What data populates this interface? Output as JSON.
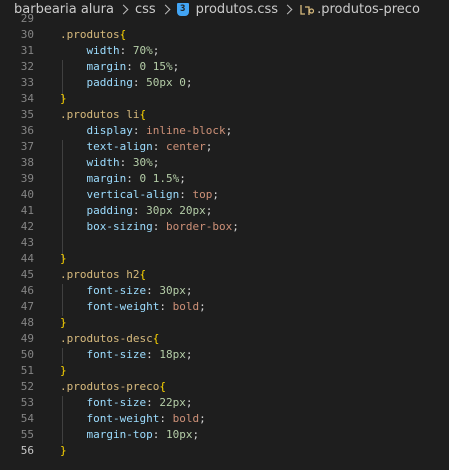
{
  "breadcrumb": {
    "folder1": "barbearia alura",
    "folder2": "css",
    "file": "produtos.css",
    "symbol": ".produtos-preco",
    "css_icon_glyph": "3",
    "css_icon_color": "#42a5f5"
  },
  "editor": {
    "active_line": 56,
    "lines": [
      {
        "n": "29",
        "tokens": []
      },
      {
        "n": "30",
        "tokens": [
          [
            "sel",
            ".produtos"
          ],
          [
            "brace",
            "{"
          ]
        ]
      },
      {
        "n": "31",
        "tokens": [
          [
            "pad",
            "    "
          ],
          [
            "prop",
            "width"
          ],
          [
            "pun",
            ": "
          ],
          [
            "num",
            "70%"
          ],
          [
            "pun",
            ";"
          ]
        ]
      },
      {
        "n": "32",
        "tokens": [
          [
            "pad",
            "    "
          ],
          [
            "prop",
            "margin"
          ],
          [
            "pun",
            ": "
          ],
          [
            "num",
            "0 15%"
          ],
          [
            "pun",
            ";"
          ]
        ]
      },
      {
        "n": "33",
        "tokens": [
          [
            "pad",
            "    "
          ],
          [
            "prop",
            "padding"
          ],
          [
            "pun",
            ": "
          ],
          [
            "num",
            "50px 0"
          ],
          [
            "pun",
            ";"
          ]
        ]
      },
      {
        "n": "34",
        "tokens": [
          [
            "brace",
            "}"
          ]
        ]
      },
      {
        "n": "35",
        "tokens": [
          [
            "sel",
            ".produtos li"
          ],
          [
            "brace",
            "{"
          ]
        ]
      },
      {
        "n": "36",
        "tokens": [
          [
            "pad",
            "    "
          ],
          [
            "prop",
            "display"
          ],
          [
            "pun",
            ": "
          ],
          [
            "val",
            "inline-block"
          ],
          [
            "pun",
            ";"
          ]
        ]
      },
      {
        "n": "37",
        "tokens": [
          [
            "pad",
            "    "
          ],
          [
            "prop",
            "text-align"
          ],
          [
            "pun",
            ": "
          ],
          [
            "val",
            "center"
          ],
          [
            "pun",
            ";"
          ]
        ]
      },
      {
        "n": "38",
        "tokens": [
          [
            "pad",
            "    "
          ],
          [
            "prop",
            "width"
          ],
          [
            "pun",
            ": "
          ],
          [
            "num",
            "30%"
          ],
          [
            "pun",
            ";"
          ]
        ]
      },
      {
        "n": "39",
        "tokens": [
          [
            "pad",
            "    "
          ],
          [
            "prop",
            "margin"
          ],
          [
            "pun",
            ": "
          ],
          [
            "num",
            "0 1.5%"
          ],
          [
            "pun",
            ";"
          ]
        ]
      },
      {
        "n": "40",
        "tokens": [
          [
            "pad",
            "    "
          ],
          [
            "prop",
            "vertical-align"
          ],
          [
            "pun",
            ": "
          ],
          [
            "val",
            "top"
          ],
          [
            "pun",
            ";"
          ]
        ]
      },
      {
        "n": "41",
        "tokens": [
          [
            "pad",
            "    "
          ],
          [
            "prop",
            "padding"
          ],
          [
            "pun",
            ": "
          ],
          [
            "num",
            "30px 20px"
          ],
          [
            "pun",
            ";"
          ]
        ]
      },
      {
        "n": "42",
        "tokens": [
          [
            "pad",
            "    "
          ],
          [
            "prop",
            "box-sizing"
          ],
          [
            "pun",
            ": "
          ],
          [
            "val",
            "border-box"
          ],
          [
            "pun",
            ";"
          ]
        ]
      },
      {
        "n": "43",
        "tokens": []
      },
      {
        "n": "44",
        "tokens": [
          [
            "brace",
            "}"
          ]
        ]
      },
      {
        "n": "45",
        "tokens": [
          [
            "sel",
            ".produtos h2"
          ],
          [
            "brace",
            "{"
          ]
        ]
      },
      {
        "n": "46",
        "tokens": [
          [
            "pad",
            "    "
          ],
          [
            "prop",
            "font-size"
          ],
          [
            "pun",
            ": "
          ],
          [
            "num",
            "30px"
          ],
          [
            "pun",
            ";"
          ]
        ]
      },
      {
        "n": "47",
        "tokens": [
          [
            "pad",
            "    "
          ],
          [
            "prop",
            "font-weight"
          ],
          [
            "pun",
            ": "
          ],
          [
            "val",
            "bold"
          ],
          [
            "pun",
            ";"
          ]
        ]
      },
      {
        "n": "48",
        "tokens": [
          [
            "brace",
            "}"
          ]
        ]
      },
      {
        "n": "49",
        "tokens": [
          [
            "sel",
            ".produtos-desc"
          ],
          [
            "brace",
            "{"
          ]
        ]
      },
      {
        "n": "50",
        "tokens": [
          [
            "pad",
            "    "
          ],
          [
            "prop",
            "font-size"
          ],
          [
            "pun",
            ": "
          ],
          [
            "num",
            "18px"
          ],
          [
            "pun",
            ";"
          ]
        ]
      },
      {
        "n": "51",
        "tokens": [
          [
            "brace",
            "}"
          ]
        ]
      },
      {
        "n": "52",
        "tokens": [
          [
            "sel",
            ".produtos-preco"
          ],
          [
            "brace",
            "{"
          ]
        ]
      },
      {
        "n": "53",
        "tokens": [
          [
            "pad",
            "    "
          ],
          [
            "prop",
            "font-size"
          ],
          [
            "pun",
            ": "
          ],
          [
            "num",
            "22px"
          ],
          [
            "pun",
            ";"
          ]
        ]
      },
      {
        "n": "54",
        "tokens": [
          [
            "pad",
            "    "
          ],
          [
            "prop",
            "font-weight"
          ],
          [
            "pun",
            ": "
          ],
          [
            "val",
            "bold"
          ],
          [
            "pun",
            ";"
          ]
        ]
      },
      {
        "n": "55",
        "tokens": [
          [
            "pad",
            "    "
          ],
          [
            "prop",
            "margin-top"
          ],
          [
            "pun",
            ": "
          ],
          [
            "num",
            "10px"
          ],
          [
            "pun",
            ";"
          ]
        ]
      },
      {
        "n": "56",
        "tokens": [
          [
            "brace",
            "}"
          ]
        ]
      }
    ]
  }
}
